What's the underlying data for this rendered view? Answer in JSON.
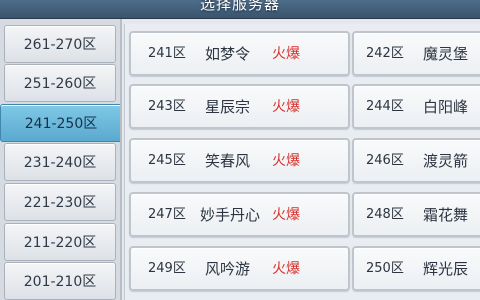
{
  "header": {
    "title": "选择服务器"
  },
  "sidebar": {
    "items": [
      {
        "label": "261-270区",
        "active": false
      },
      {
        "label": "251-260区",
        "active": false
      },
      {
        "label": "241-250区",
        "active": true
      },
      {
        "label": "231-240区",
        "active": false
      },
      {
        "label": "221-230区",
        "active": false
      },
      {
        "label": "211-220区",
        "active": false
      },
      {
        "label": "201-210区",
        "active": false
      }
    ]
  },
  "servers": [
    {
      "number": "241区",
      "name": "如梦令",
      "status": "火爆"
    },
    {
      "number": "242区",
      "name": "魔灵堡"
    },
    {
      "number": "243区",
      "name": "星辰宗",
      "status": "火爆"
    },
    {
      "number": "244区",
      "name": "白阳峰"
    },
    {
      "number": "245区",
      "name": "笑春风",
      "status": "火爆"
    },
    {
      "number": "246区",
      "name": "渡灵箭"
    },
    {
      "number": "247区",
      "name": "妙手丹心",
      "status": "火爆"
    },
    {
      "number": "248区",
      "name": "霜花舞"
    },
    {
      "number": "249区",
      "name": "风吟游",
      "status": "火爆"
    },
    {
      "number": "250区",
      "name": "辉光辰"
    }
  ],
  "colors": {
    "status_hot": "#d8312c",
    "active_tab": "#6bb8dc",
    "header": "#45617c"
  }
}
